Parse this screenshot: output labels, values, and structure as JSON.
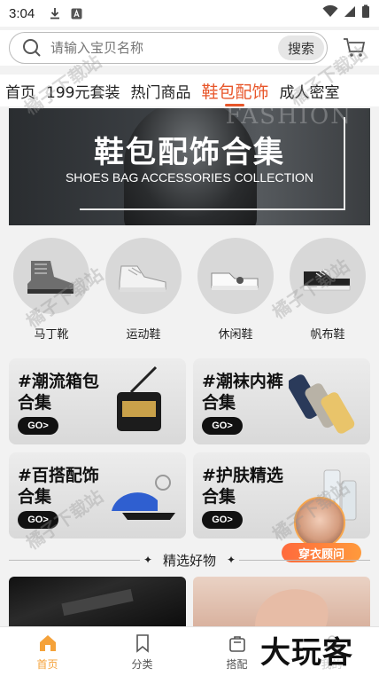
{
  "status_bar": {
    "time": "3:04"
  },
  "search": {
    "placeholder": "请输入宝贝名称",
    "button_label": "搜索"
  },
  "tabs": [
    {
      "label": "首页",
      "active": false
    },
    {
      "label": "199元套装",
      "active": false
    },
    {
      "label": "热门商品",
      "active": false
    },
    {
      "label": "鞋包配饰",
      "active": true
    },
    {
      "label": "成人密室",
      "active": false
    }
  ],
  "banner": {
    "title": "鞋包配饰合集",
    "subtitle": "SHOES BAG ACCESSORIES COLLECTION",
    "bg_word": "FASHION"
  },
  "categories": [
    {
      "label": "马丁靴",
      "icon": "martin-boot-icon"
    },
    {
      "label": "运动鞋",
      "icon": "sneaker-icon"
    },
    {
      "label": "休闲鞋",
      "icon": "casual-shoe-icon"
    },
    {
      "label": "帆布鞋",
      "icon": "canvas-shoe-icon"
    }
  ],
  "promo_cards": [
    {
      "line1": "#潮流箱包",
      "line2": "合集",
      "go": "GO>"
    },
    {
      "line1": "#潮袜内裤",
      "line2": "合集",
      "go": "GO>"
    },
    {
      "line1": "#百搭配饰",
      "line2": "合集",
      "go": "GO>"
    },
    {
      "line1": "#护肤精选",
      "line2": "合集",
      "go": "GO>"
    }
  ],
  "section": {
    "title": "精选好物"
  },
  "advisor": {
    "label": "穿衣顾问"
  },
  "bottom_nav": [
    {
      "label": "首页",
      "active": true,
      "icon": "home-icon"
    },
    {
      "label": "分类",
      "active": false,
      "icon": "bookmark-icon"
    },
    {
      "label": "搭配",
      "active": false,
      "icon": "bag-icon"
    },
    {
      "label": "我的",
      "active": false,
      "icon": "user-icon"
    }
  ],
  "watermark": {
    "site": "橘子下载站",
    "logo": "大玩客"
  },
  "colors": {
    "accent": "#e8562a",
    "nav_active": "#f5a23a"
  }
}
